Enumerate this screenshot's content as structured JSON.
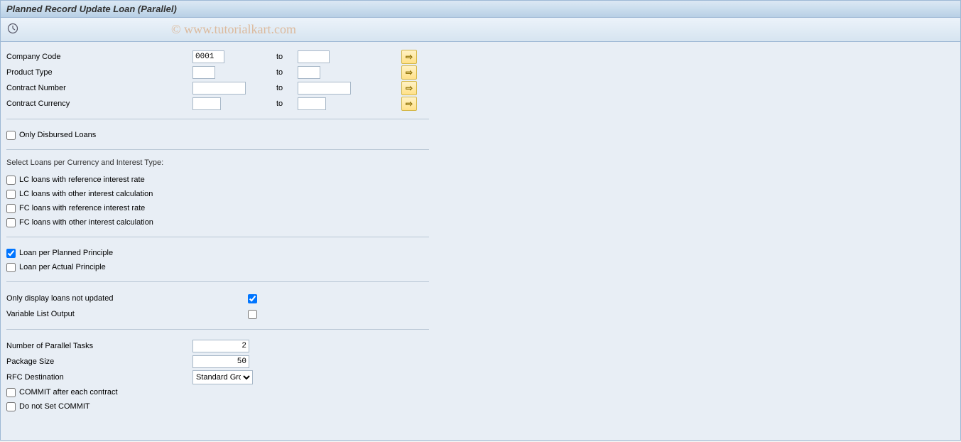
{
  "title": "Planned Record Update Loan (Parallel)",
  "watermark": "© www.tutorialkart.com",
  "selection": {
    "company_code": {
      "label": "Company Code",
      "from": "0001",
      "to_label": "to",
      "to": ""
    },
    "product_type": {
      "label": "Product Type",
      "from": "",
      "to_label": "to",
      "to": ""
    },
    "contract_number": {
      "label": "Contract Number",
      "from": "",
      "to_label": "to",
      "to": ""
    },
    "contract_currency": {
      "label": "Contract Currency",
      "from": "",
      "to_label": "to",
      "to": ""
    }
  },
  "only_disbursed": {
    "label": "Only Disbursed Loans",
    "checked": false
  },
  "loan_types": {
    "heading": "Select Loans per Currency and Interest Type:",
    "lc_ref": {
      "label": "LC loans with reference interest rate",
      "checked": false
    },
    "lc_other": {
      "label": "LC loans with other interest calculation",
      "checked": false
    },
    "fc_ref": {
      "label": "FC loans with reference interest rate",
      "checked": false
    },
    "fc_other": {
      "label": "FC loans with other interest calculation",
      "checked": false
    }
  },
  "principle": {
    "planned": {
      "label": "Loan per Planned Principle",
      "checked": true
    },
    "actual": {
      "label": "Loan per Actual Principle",
      "checked": false
    }
  },
  "display_opts": {
    "not_updated": {
      "label": "Only display loans not updated",
      "checked": true
    },
    "variable_list": {
      "label": "Variable List Output",
      "checked": false
    }
  },
  "parallel": {
    "tasks": {
      "label": "Number of Parallel Tasks",
      "value": "2"
    },
    "package": {
      "label": "Package Size",
      "value": "50"
    },
    "rfc": {
      "label": "RFC Destination",
      "value": "Standard Gro…"
    },
    "commit_each": {
      "label": "COMMIT after each contract",
      "checked": false
    },
    "no_commit": {
      "label": "Do not Set COMMIT",
      "checked": false
    }
  }
}
